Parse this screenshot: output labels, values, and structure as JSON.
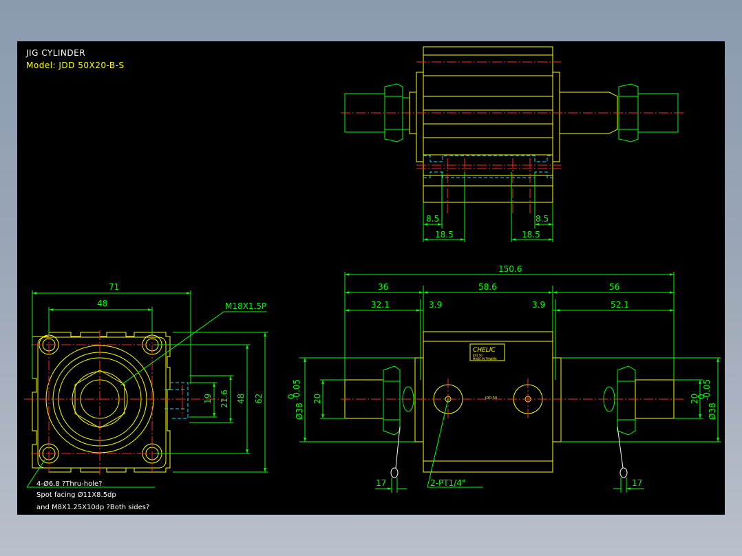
{
  "title": {
    "line1": "JIG CYLINDER",
    "line2": "Model:  JDD 50X20-B-S"
  },
  "colors": {
    "background": "#000000",
    "outline": "#ffff00",
    "dimension": "#00ff00",
    "centerline": "#ff2a2a",
    "hidden": "#00e5ff",
    "window_gradient_top": "#8a9bb0"
  },
  "top_view": {
    "dims": {
      "d1": "8.5",
      "d2": "8.5",
      "d3": "18.5",
      "d4": "18.5"
    }
  },
  "front_view": {
    "dims": {
      "overall": "150.6",
      "left": "36",
      "middle": "58.6",
      "right": "56",
      "left_rod": "32.1",
      "left_gap": "3.9",
      "right_gap": "3.9",
      "right_rod": "52.1",
      "rod_dia_left": "20",
      "rod_dia_right": "20",
      "bore_left": "Ø38",
      "bore_right": "Ø38",
      "tol_upper": "0",
      "tol_lower": "-0.05",
      "port_callout": "2-PT1/4\"",
      "nut_left": "17",
      "nut_right": "17"
    },
    "nameplate": {
      "brand": "CHELIC",
      "line1": "JDD 50",
      "line2": "MADE IN TAIWAN"
    },
    "body_label": "JDD 50"
  },
  "side_view": {
    "dims": {
      "width": "71",
      "pitch": "48",
      "thread": "M18X1.5P",
      "h1": "19",
      "h2": "21.6",
      "h3": "48",
      "h4": "62"
    },
    "notes": [
      "4-Ø6.8   ?Thru-hole?",
      "Spot facing  Ø11X8.5dp",
      "and M8X1.25X10dp ?Both sides?"
    ]
  }
}
